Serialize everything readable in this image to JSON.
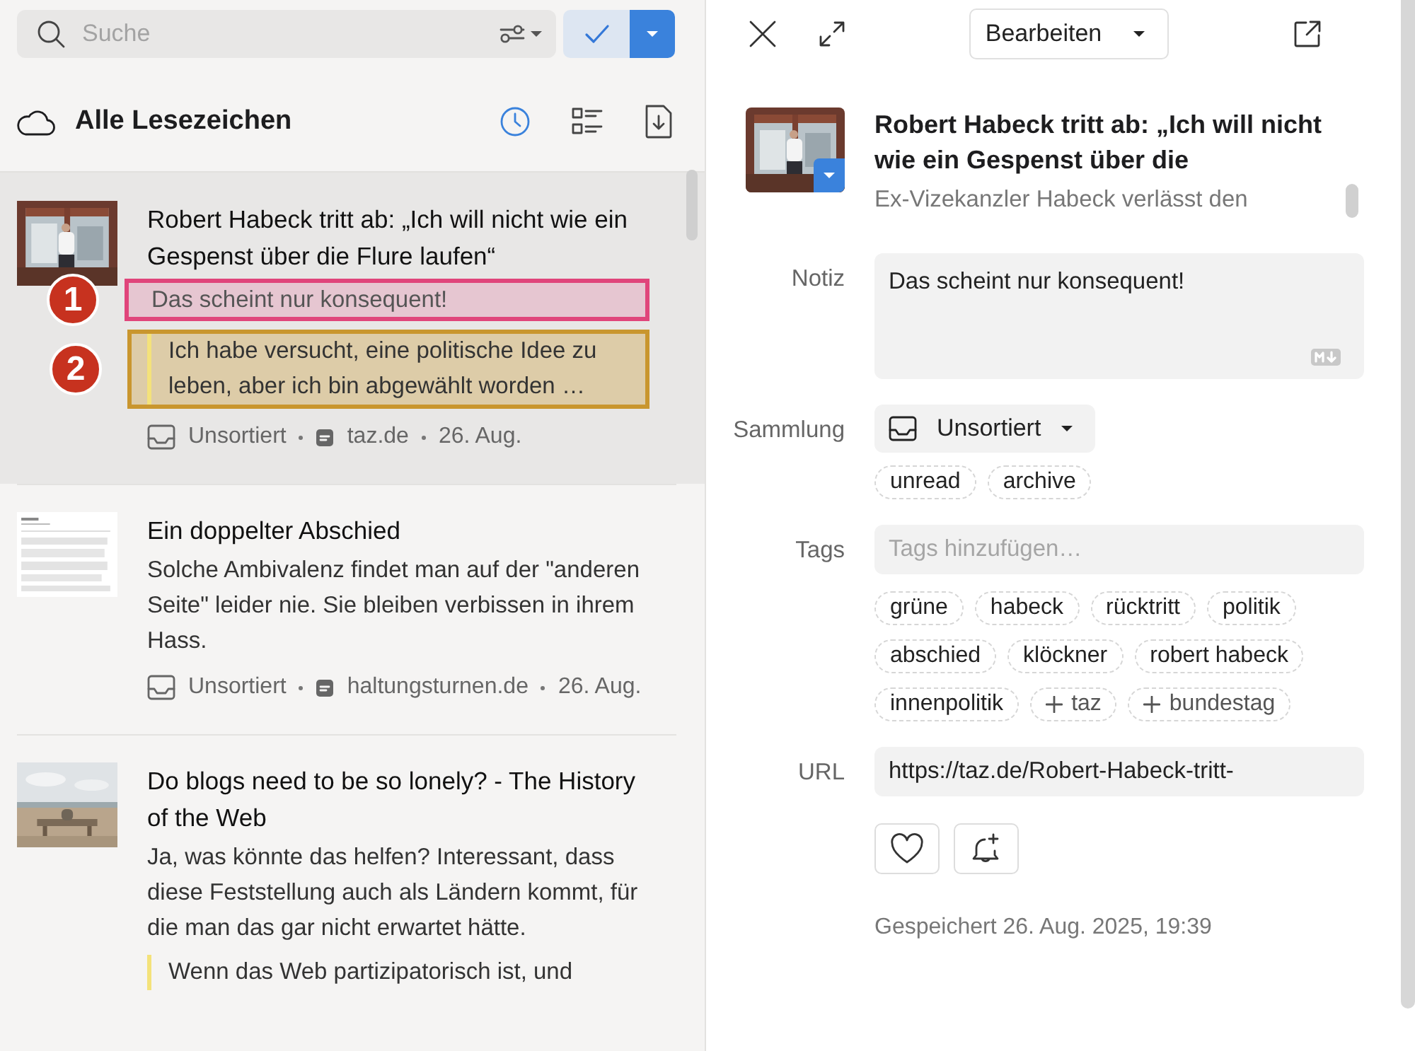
{
  "search": {
    "placeholder": "Suche"
  },
  "header": {
    "title": "Alle Lesezeichen"
  },
  "bookmarks": [
    {
      "title": "Robert Habeck tritt ab: „Ich will nicht wie ein Gespenst über die Flure laufen“",
      "selected": true,
      "note": {
        "text": "Das scheint nur konsequent!",
        "callout": "1",
        "color": "#e0457b"
      },
      "highlights": [
        {
          "text": "Ich habe versucht, eine politische Idee zu leben, aber ich bin abgewählt worden …",
          "callout": "2",
          "color": "#c9962e"
        }
      ],
      "collection": "Unsortiert",
      "domain": "taz.de",
      "date": "26. Aug."
    },
    {
      "title": "Ein doppelter Abschied",
      "selected": false,
      "excerpt": "Solche Ambivalenz findet man auf der \"anderen Seite\" leider nie. Sie bleiben verbissen in ihrem Hass.",
      "collection": "Unsortiert",
      "domain": "haltungsturnen.de",
      "date": "26. Aug."
    },
    {
      "title": "Do blogs need to be so lonely? - The History of the Web",
      "selected": false,
      "excerpt": "Ja, was könnte das helfen? Interessant, dass diese Feststellung auch als Ländern kommt, für die man das gar nicht erwartet hätte.",
      "highlights": [
        {
          "text": "Wenn das Web partizipatorisch ist, und"
        }
      ]
    }
  ],
  "detail": {
    "edit_button": "Bearbeiten",
    "preview": {
      "title": "Robert Habeck tritt ab: „Ich will nicht wie ein Gespenst über die",
      "description": "Ex-Vizekanzler Habeck verlässt den"
    },
    "note": {
      "label": "Notiz",
      "value": "Das scheint nur konsequent!"
    },
    "collection": {
      "label": "Sammlung",
      "value": "Unsortiert",
      "chips": [
        "unread",
        "archive"
      ]
    },
    "tags": {
      "label": "Tags",
      "placeholder": "Tags hinzufügen…",
      "items": [
        {
          "text": "grüne",
          "kind": "tag"
        },
        {
          "text": "habeck",
          "kind": "tag"
        },
        {
          "text": "rücktritt",
          "kind": "tag"
        },
        {
          "text": "politik",
          "kind": "tag"
        },
        {
          "text": "abschied",
          "kind": "tag"
        },
        {
          "text": "klöckner",
          "kind": "tag"
        },
        {
          "text": "robert habeck",
          "kind": "tag"
        },
        {
          "text": "innenpolitik",
          "kind": "tag"
        },
        {
          "text": "taz",
          "kind": "suggestion"
        },
        {
          "text": "bundestag",
          "kind": "suggestion"
        }
      ]
    },
    "url": {
      "label": "URL",
      "value": "https://taz.de/Robert-Habeck-tritt-"
    },
    "saved": "Gespeichert 26. Aug. 2025, 19:39"
  }
}
